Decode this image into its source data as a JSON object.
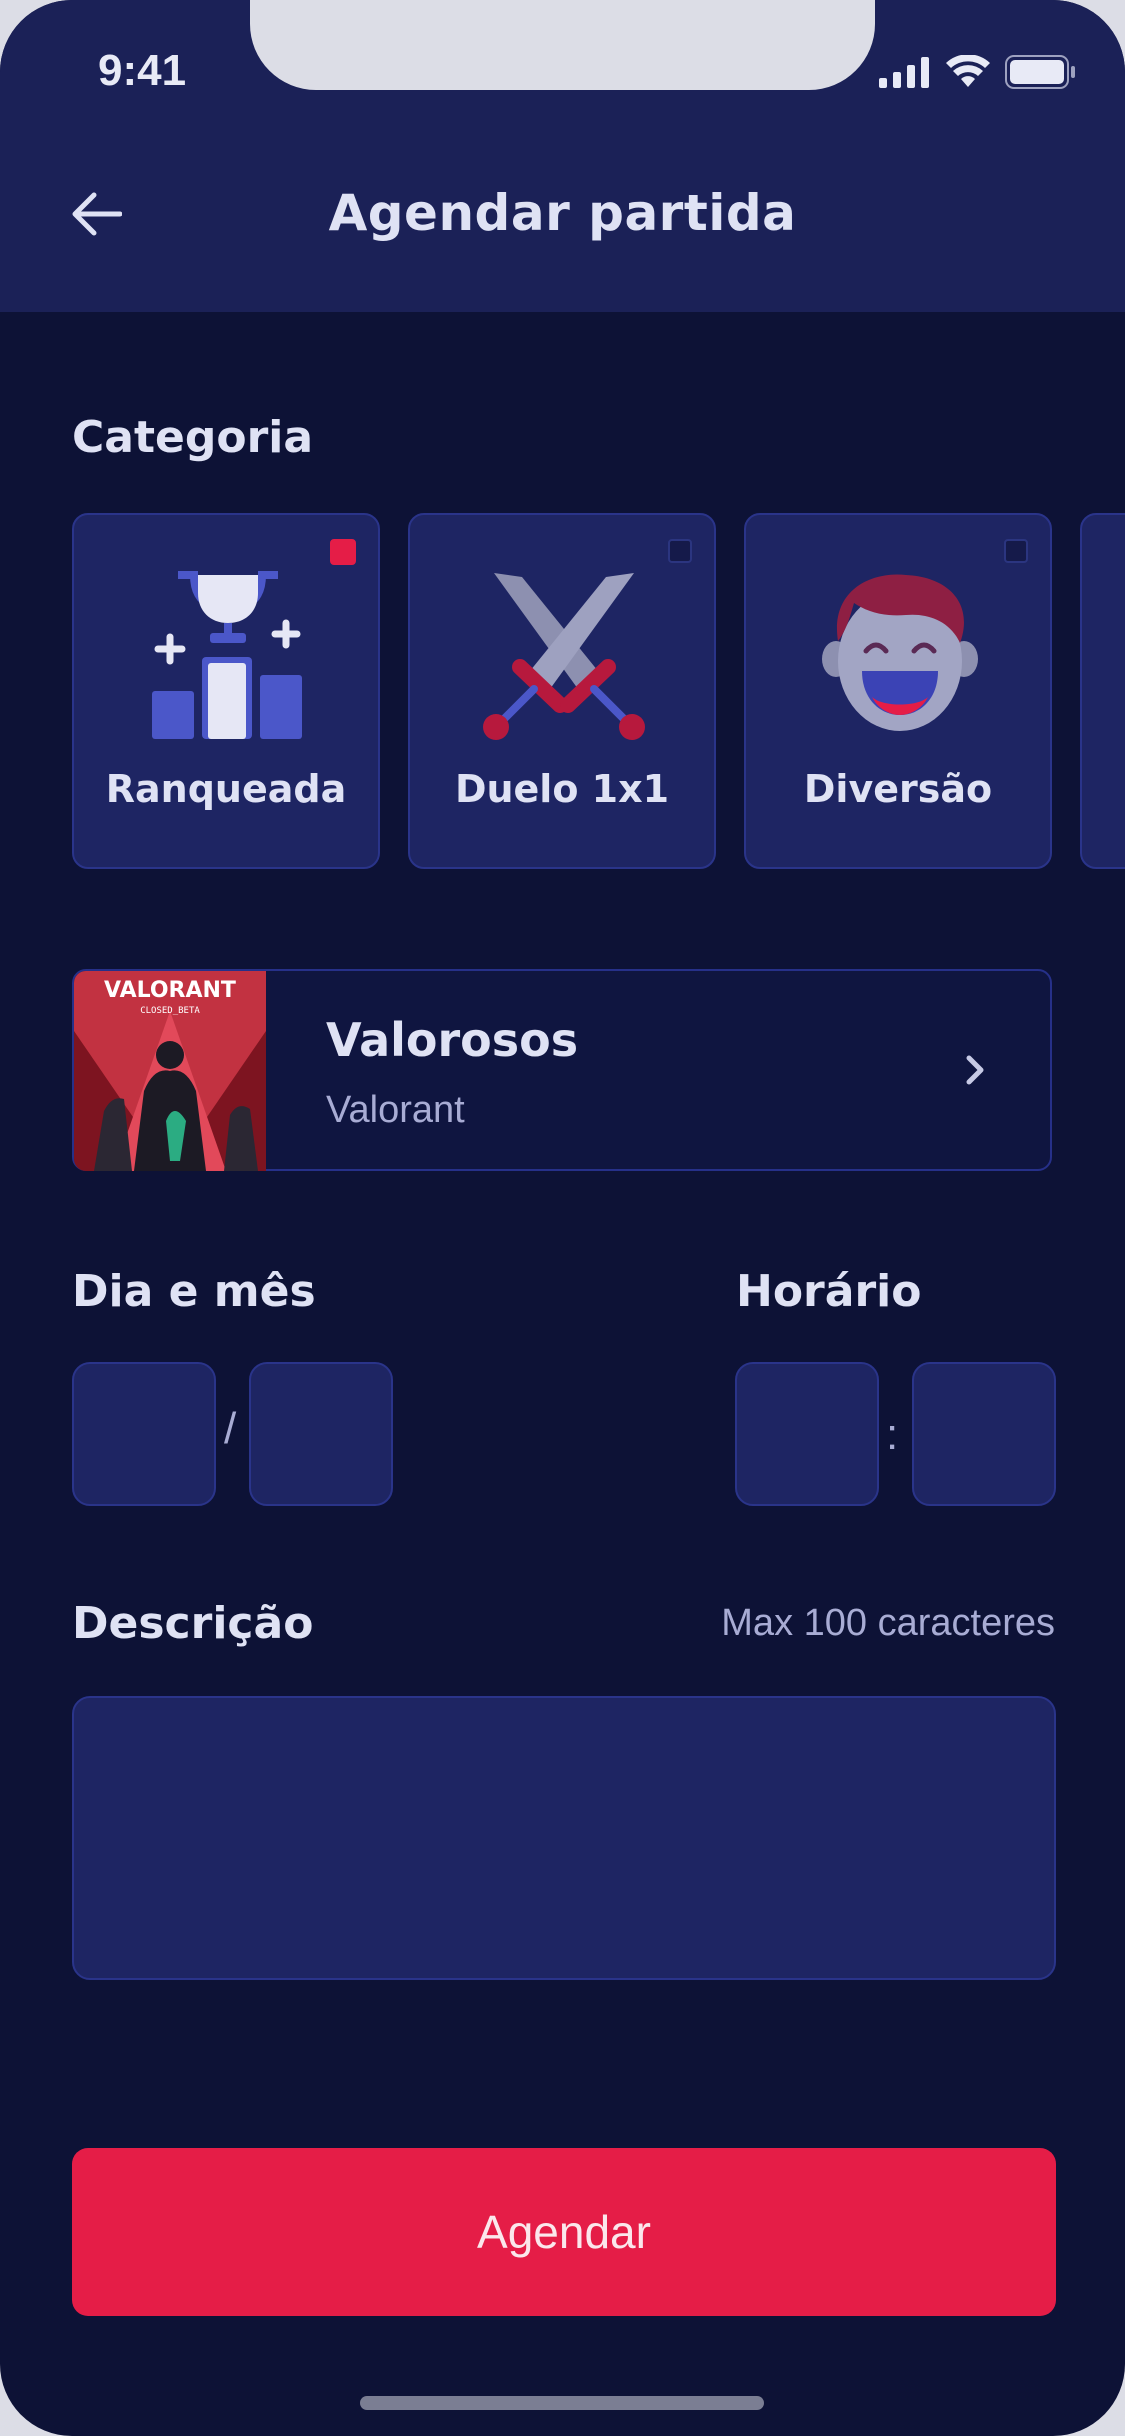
{
  "status_bar": {
    "time": "9:41"
  },
  "header": {
    "title": "Agendar partida",
    "back_icon": "arrow-left-icon"
  },
  "category": {
    "label": "Categoria",
    "items": [
      {
        "label": "Ranqueada",
        "icon": "trophy-podium-icon",
        "selected": true
      },
      {
        "label": "Duelo 1x1",
        "icon": "crossed-swords-icon",
        "selected": false
      },
      {
        "label": "Diversão",
        "icon": "laughing-face-icon",
        "selected": false
      }
    ]
  },
  "guild": {
    "name": "Valorosos",
    "game": "Valorant",
    "thumbnail_text": "VALORANT",
    "thumbnail_subtext": "CLOSED_BETA"
  },
  "date": {
    "label": "Dia e mês",
    "separator": "/",
    "day": "",
    "month": ""
  },
  "time": {
    "label": "Horário",
    "separator": ":",
    "hour": "",
    "minute": ""
  },
  "description": {
    "label": "Descrição",
    "hint": "Max 100 caracteres",
    "value": ""
  },
  "submit": {
    "label": "Agendar"
  },
  "colors": {
    "background": "#0d1236",
    "header": "#1b2157",
    "accent": "#e51d47",
    "card": "#1e2563",
    "border": "#2a348a"
  }
}
